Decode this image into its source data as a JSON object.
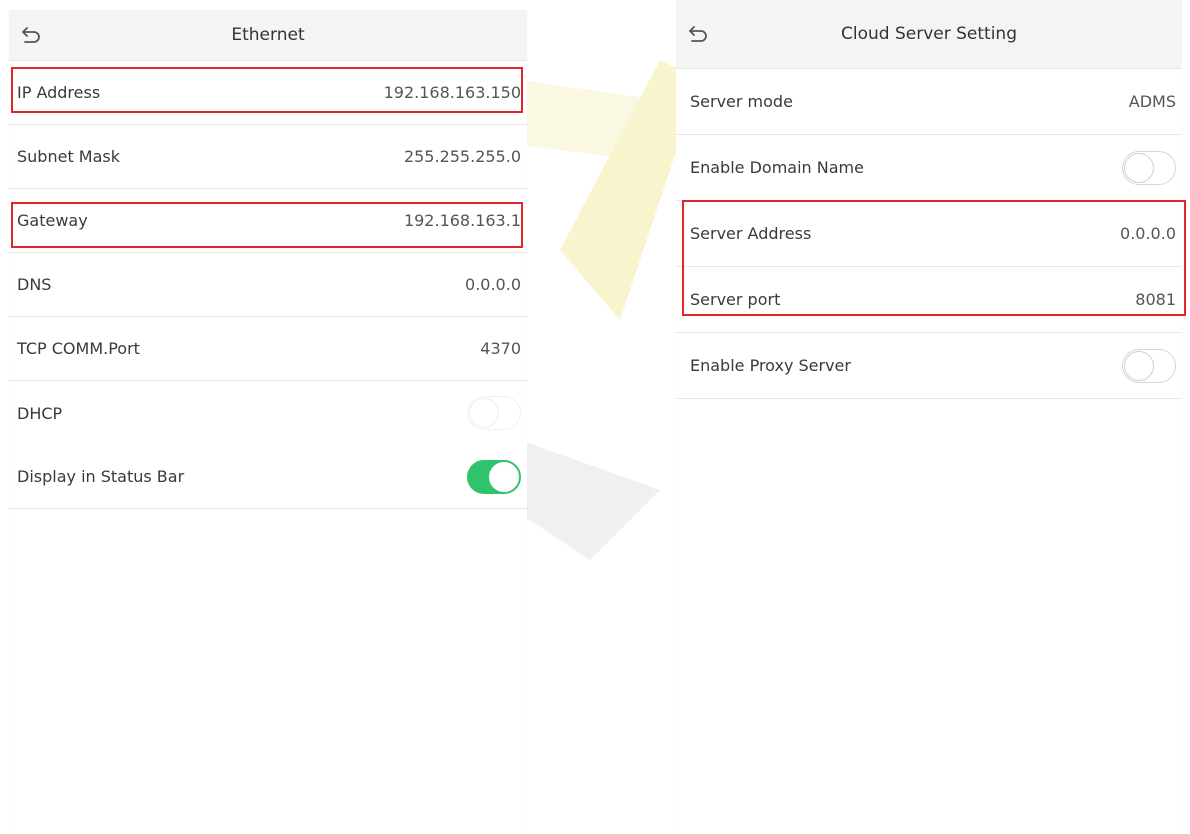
{
  "left_screen": {
    "title": "Ethernet",
    "rows": [
      {
        "label": "IP Address",
        "value": "192.168.163.150"
      },
      {
        "label": "Subnet Mask",
        "value": "255.255.255.0"
      },
      {
        "label": "Gateway",
        "value": "192.168.163.1"
      },
      {
        "label": "DNS",
        "value": "0.0.0.0"
      },
      {
        "label": "TCP COMM.Port",
        "value": "4370"
      },
      {
        "label": "DHCP",
        "toggle": "off"
      },
      {
        "label": "Display in Status Bar",
        "toggle": "on"
      }
    ]
  },
  "right_screen": {
    "title": "Cloud Server Setting",
    "rows": [
      {
        "label": "Server mode",
        "value": "ADMS"
      },
      {
        "label": "Enable Domain Name",
        "toggle": "off"
      },
      {
        "label": "Server Address",
        "value": "0.0.0.0"
      },
      {
        "label": "Server port",
        "value": "8081"
      },
      {
        "label": "Enable Proxy Server",
        "toggle": "off"
      }
    ]
  },
  "colors": {
    "highlight": "#e0262b",
    "toggle_on": "#2fc36c",
    "watermark": "#f3f0a0"
  },
  "icons": {
    "back": "back-arrow-icon"
  }
}
